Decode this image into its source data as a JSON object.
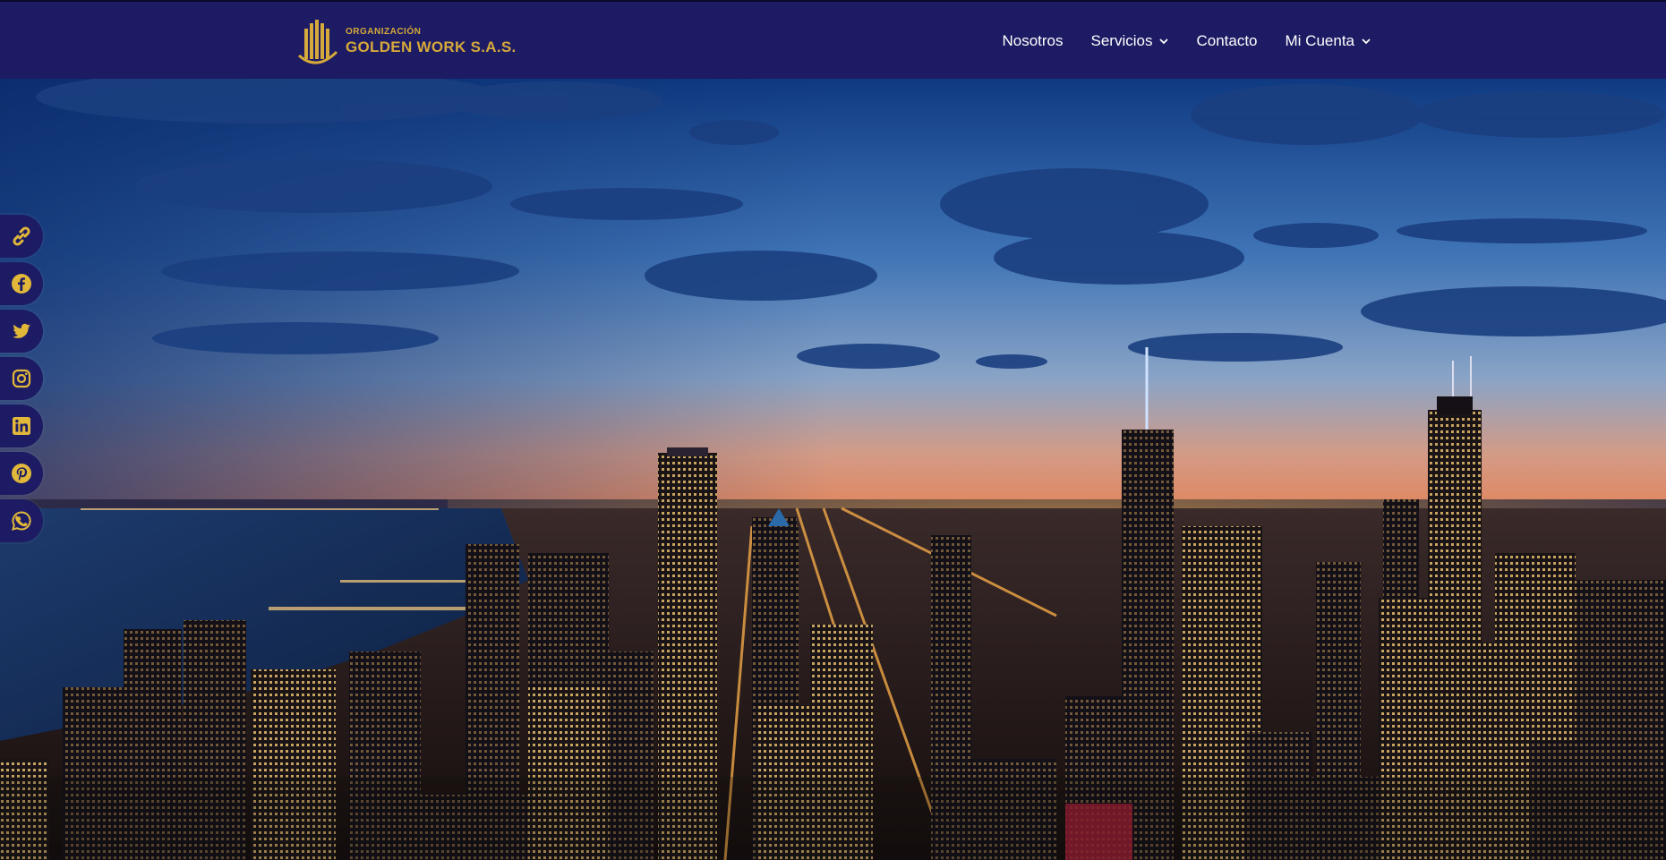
{
  "brand": {
    "small": "ORGANIZACIÓN",
    "name": "GOLDEN WORK S.A.S.",
    "color": "#d6a93b",
    "header_bg": "#1c1b63"
  },
  "nav": {
    "items": [
      {
        "label": "Nosotros",
        "has_dropdown": false
      },
      {
        "label": "Servicios",
        "has_dropdown": true
      },
      {
        "label": "Contacto",
        "has_dropdown": false
      },
      {
        "label": "Mi Cuenta",
        "has_dropdown": true
      }
    ]
  },
  "social": {
    "icons": [
      "link-icon",
      "facebook-icon",
      "twitter-icon",
      "instagram-icon",
      "linkedin-icon",
      "pinterest-icon",
      "whatsapp-icon"
    ],
    "icon_color": "#e2b83a"
  },
  "hero": {
    "image": "city-skyline-at-dusk"
  }
}
